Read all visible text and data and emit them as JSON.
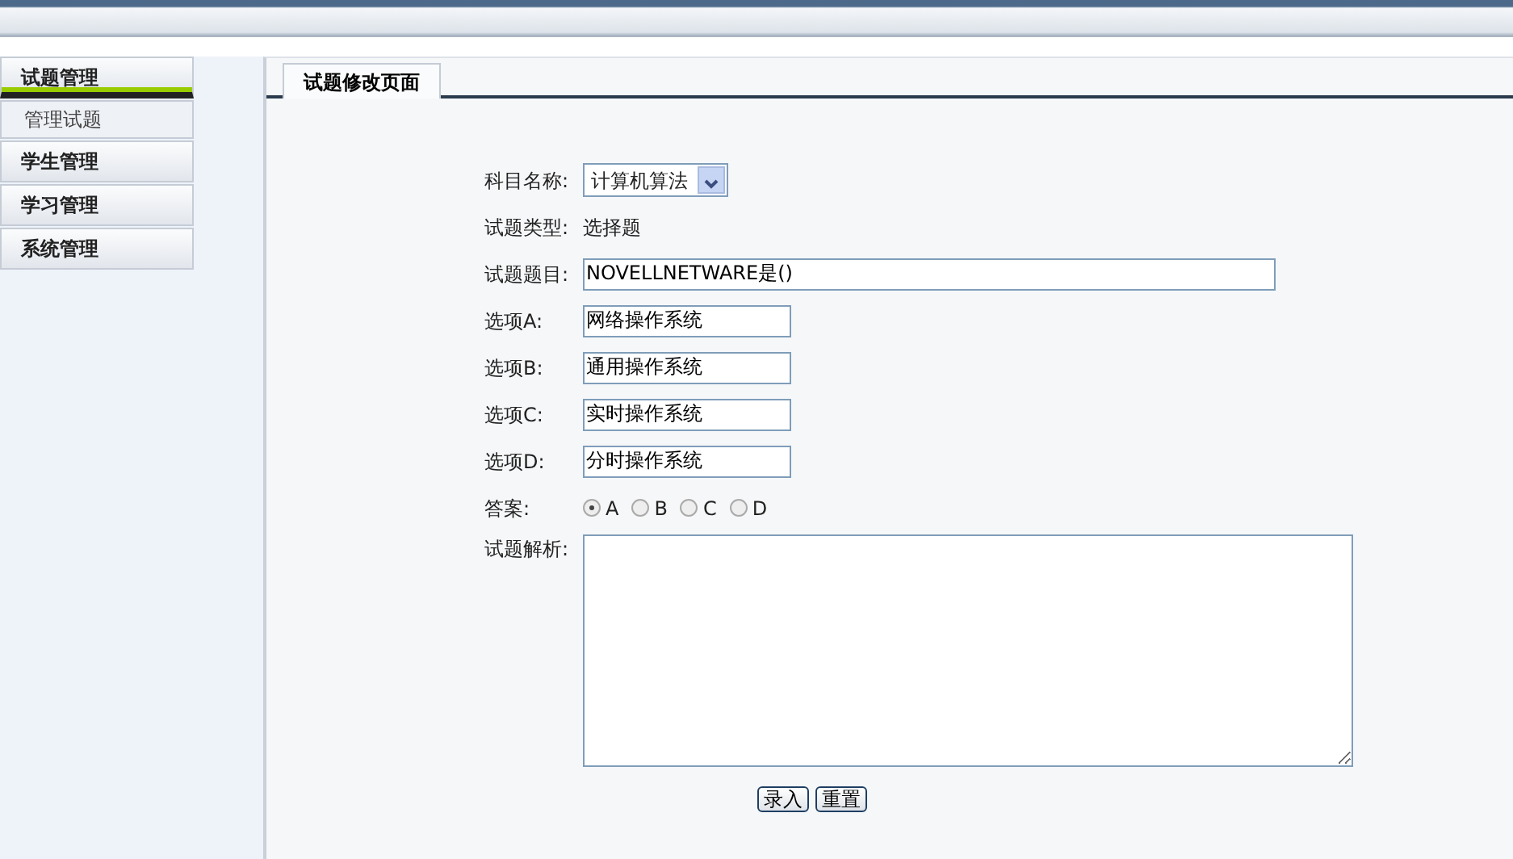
{
  "sidebar": {
    "groups": [
      {
        "label": "试题管理",
        "expanded": true,
        "children": [
          {
            "label": "管理试题"
          }
        ]
      },
      {
        "label": "学生管理",
        "expanded": false
      },
      {
        "label": "学习管理",
        "expanded": false
      },
      {
        "label": "系统管理",
        "expanded": false
      }
    ]
  },
  "tab": {
    "label": "试题修改页面",
    "selected": true
  },
  "form": {
    "rows": [
      {
        "kind": "select",
        "label": "科目名称:",
        "value": "计算机算法"
      },
      {
        "kind": "text",
        "label": "试题类型:",
        "value": "选择题"
      },
      {
        "kind": "input",
        "label": "试题题目:",
        "value": "NOVELLNETWARE是()",
        "wide": true
      },
      {
        "kind": "input",
        "label": "选项A:",
        "value": "网络操作系统"
      },
      {
        "kind": "input",
        "label": "选项B:",
        "value": "通用操作系统"
      },
      {
        "kind": "input",
        "label": "选项C:",
        "value": "实时操作系统"
      },
      {
        "kind": "input",
        "label": "选项D:",
        "value": "分时操作系统"
      },
      {
        "kind": "radio",
        "label": "答案:",
        "options": [
          {
            "label": "A",
            "selected": true
          },
          {
            "label": "B",
            "selected": false
          },
          {
            "label": "C",
            "selected": false
          },
          {
            "label": "D",
            "selected": false
          }
        ]
      },
      {
        "kind": "textarea",
        "label": "试题解析:"
      }
    ],
    "buttons": [
      "录入",
      "重置"
    ]
  }
}
